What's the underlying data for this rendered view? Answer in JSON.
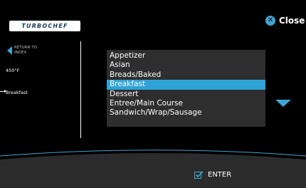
{
  "brand": {
    "logo_text": "TURBOCHEF"
  },
  "header": {
    "close_label": "Close"
  },
  "sidebar": {
    "return_label": "RETURN TO INDEX",
    "temperature": "450°F",
    "selected": "Breakfast"
  },
  "categories": {
    "items": [
      "Appetizer",
      "Asian",
      "Breads/Baked",
      "Breakfast",
      "Dessert",
      "Entree/Main Course",
      "Sandwich/Wrap/Sausage"
    ],
    "selected": "Breakfast"
  },
  "footer": {
    "enter_label": "ENTER"
  },
  "colors": {
    "accent": "#3fa6d4",
    "highlight": "#2fa3d6",
    "list_bg": "#2e2e2e",
    "footer_bg": "#2b2b2b"
  },
  "icons": [
    "close-icon",
    "return-arrow-icon",
    "scroll-down-icon",
    "checkbox-check-icon"
  ]
}
